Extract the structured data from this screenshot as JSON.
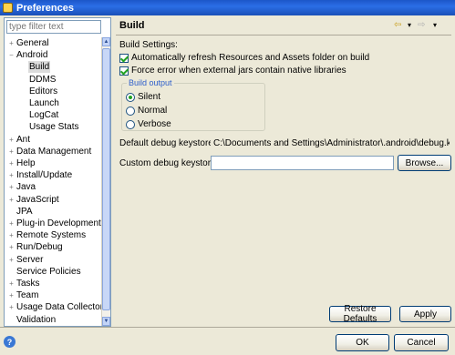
{
  "window": {
    "title": "Preferences"
  },
  "filter": {
    "placeholder": "type filter text"
  },
  "tree": {
    "items": [
      {
        "label": "General",
        "expander": "+",
        "indent": 0
      },
      {
        "label": "Android",
        "expander": "−",
        "indent": 0
      },
      {
        "label": "Build",
        "expander": "",
        "indent": 1,
        "selected": true
      },
      {
        "label": "DDMS",
        "expander": "",
        "indent": 1
      },
      {
        "label": "Editors",
        "expander": "",
        "indent": 1
      },
      {
        "label": "Launch",
        "expander": "",
        "indent": 1
      },
      {
        "label": "LogCat",
        "expander": "",
        "indent": 1
      },
      {
        "label": "Usage Stats",
        "expander": "",
        "indent": 1
      },
      {
        "label": "Ant",
        "expander": "+",
        "indent": 0
      },
      {
        "label": "Data Management",
        "expander": "+",
        "indent": 0
      },
      {
        "label": "Help",
        "expander": "+",
        "indent": 0
      },
      {
        "label": "Install/Update",
        "expander": "+",
        "indent": 0
      },
      {
        "label": "Java",
        "expander": "+",
        "indent": 0
      },
      {
        "label": "JavaScript",
        "expander": "+",
        "indent": 0
      },
      {
        "label": "JPA",
        "expander": "",
        "indent": 0
      },
      {
        "label": "Plug-in Development",
        "expander": "+",
        "indent": 0
      },
      {
        "label": "Remote Systems",
        "expander": "+",
        "indent": 0
      },
      {
        "label": "Run/Debug",
        "expander": "+",
        "indent": 0
      },
      {
        "label": "Server",
        "expander": "+",
        "indent": 0
      },
      {
        "label": "Service Policies",
        "expander": "",
        "indent": 0
      },
      {
        "label": "Tasks",
        "expander": "+",
        "indent": 0
      },
      {
        "label": "Team",
        "expander": "+",
        "indent": 0
      },
      {
        "label": "Usage Data Collector",
        "expander": "+",
        "indent": 0
      },
      {
        "label": "Validation",
        "expander": "",
        "indent": 0
      }
    ]
  },
  "page": {
    "title": "Build",
    "build_settings_label": "Build Settings:",
    "checkboxes": [
      {
        "label": "Automatically refresh Resources and Assets folder on build",
        "checked": true
      },
      {
        "label": "Force error when external jars contain native libraries",
        "checked": true
      }
    ],
    "output": {
      "legend": "Build output",
      "options": [
        {
          "label": "Silent",
          "checked": true
        },
        {
          "label": "Normal",
          "checked": false
        },
        {
          "label": "Verbose",
          "checked": false
        }
      ]
    },
    "default_keystore_label": "Default debug keystore:",
    "default_keystore_value": "C:\\Documents and Settings\\Administrator\\.android\\debug.keystore",
    "custom_keystore_label": "Custom debug keystore:",
    "custom_keystore_value": "",
    "browse_label": "Browse..."
  },
  "buttons": {
    "restore_defaults": "Restore Defaults",
    "apply": "Apply",
    "ok": "OK",
    "cancel": "Cancel"
  },
  "colors": {
    "accent": "#2e5fcb",
    "titlebar": "#2b6ee6",
    "check_mark": "#21a121",
    "dialog_bg": "#ece9d8"
  },
  "icons": [
    "back-arrow-icon",
    "dropdown-arrow-icon",
    "forward-arrow-icon",
    "menu-icon",
    "help-icon",
    "app-icon"
  ]
}
